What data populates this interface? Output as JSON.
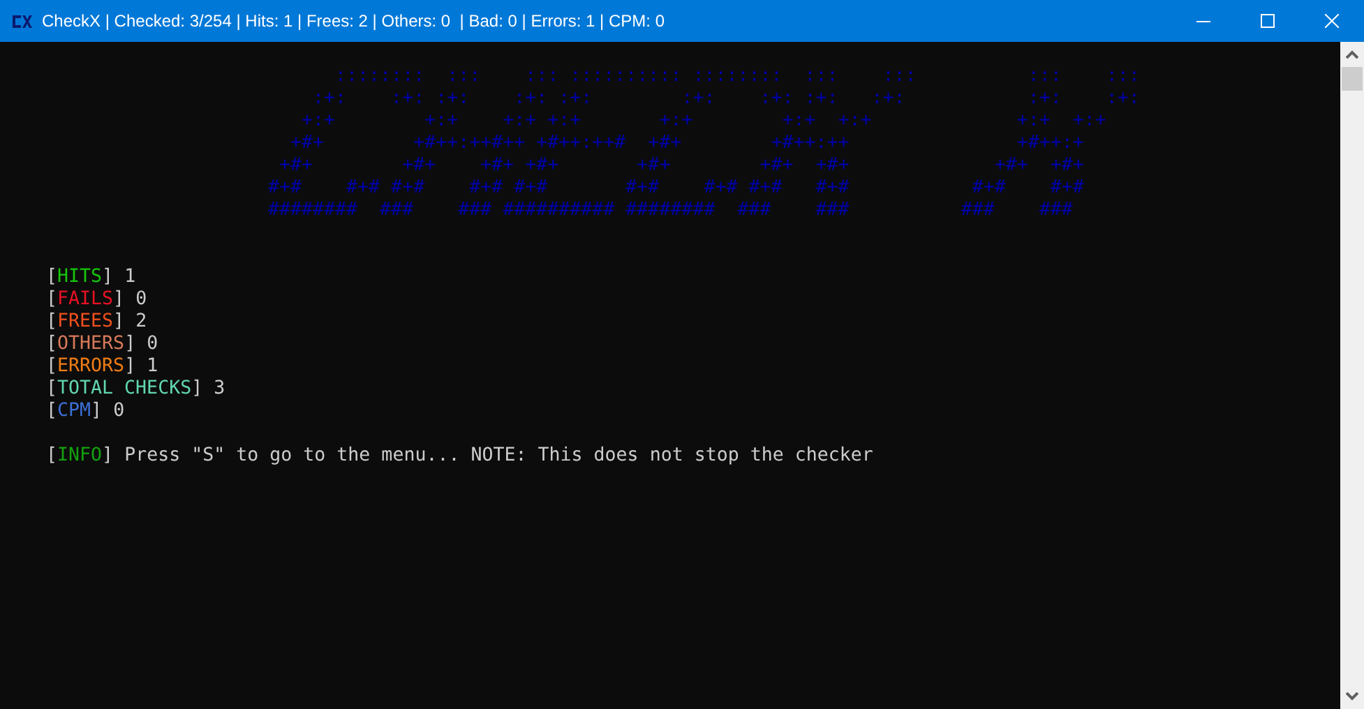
{
  "window": {
    "title": "CheckX | Checked: 3/254 | Hits: 1 | Frees: 2 | Others: 0  | Bad: 0 | Errors: 1 | CPM: 0"
  },
  "banner": {
    "lines": [
      "      ::::::::  :::    ::: :::::::::: ::::::::  :::    :::          :::    :::",
      "    :+:    :+: :+:    :+: :+:        :+:    :+: :+:   :+:           :+:    :+:",
      "   +:+        +:+    +:+ +:+       +:+        +:+  +:+             +:+  +:+",
      "  +#+        +#++:++#++ +#++:++#  +#+        +#++:++               +#++:+",
      " +#+        +#+    +#+ +#+       +#+        +#+  +#+             +#+  +#+",
      "#+#    #+# #+#    #+# #+#       #+#    #+# #+#   #+#           #+#    #+#",
      "########  ###    ### ########## ########  ###    ###          ###    ###"
    ]
  },
  "stats": [
    {
      "open": "[",
      "label": "HITS",
      "close": "]",
      "value": "1",
      "color": "#16c60c"
    },
    {
      "open": "[",
      "label": "FAILS",
      "close": "]",
      "value": "0",
      "color": "#e81123"
    },
    {
      "open": "[",
      "label": "FREES",
      "close": "]",
      "value": "2",
      "color": "#f0501e"
    },
    {
      "open": "[",
      "label": "OTHERS",
      "close": "]",
      "value": "0",
      "color": "#d77a5a"
    },
    {
      "open": "[",
      "label": "ERRORS",
      "close": "]",
      "value": "1",
      "color": "#f07d14"
    },
    {
      "open": "[",
      "label": "TOTAL CHECKS",
      "close": "]",
      "value": "3",
      "color": "#61d6b0"
    },
    {
      "open": "[",
      "label": "CPM",
      "close": "]",
      "value": "0",
      "color": "#3b6fd6"
    }
  ],
  "info": {
    "open": "[",
    "label": "INFO",
    "close": "]",
    "text": "Press \"S\" to go to the menu... NOTE: This does not stop the checker",
    "color": "#13a10e"
  }
}
